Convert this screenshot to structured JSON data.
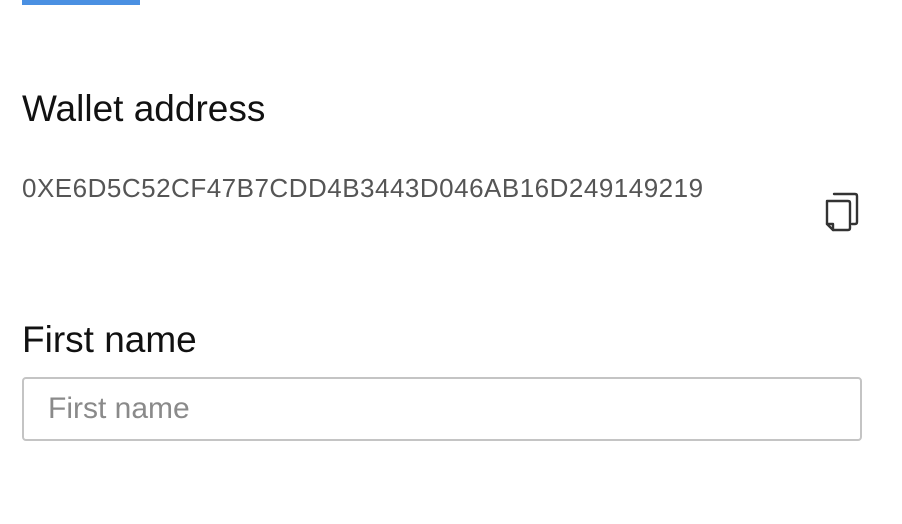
{
  "wallet": {
    "label": "Wallet address",
    "address": "0XE6D5C52CF47B7CDD4B3443D046AB16D249149219",
    "copy_icon": "copy-icon"
  },
  "first_name": {
    "label": "First name",
    "placeholder": "First name",
    "value": ""
  },
  "colors": {
    "accent": "#4a90e2",
    "label": "#111111",
    "address_text": "#555555",
    "input_border": "#c4c4c4",
    "placeholder": "#8a8a8a"
  }
}
